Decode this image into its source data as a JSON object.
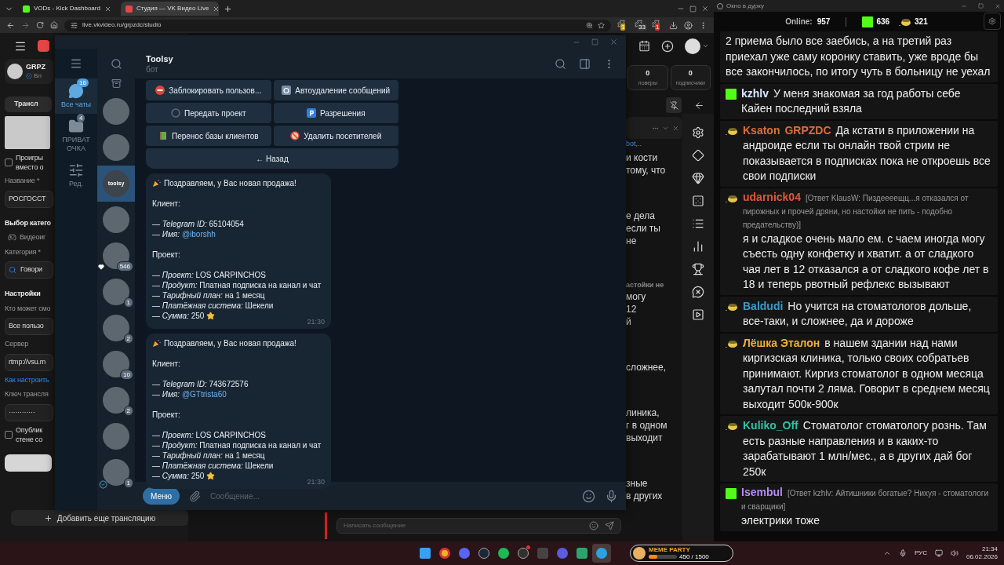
{
  "browser": {
    "tabs": [
      {
        "title": "VODs - Kick Dashboard",
        "selected": false,
        "kind": "kick"
      },
      {
        "title": "Студия — VK Видео Live",
        "selected": true,
        "kind": "vk"
      }
    ],
    "url": "live.vkvideo.ru/grpzdc/studio",
    "extensions": [
      {
        "badge": "1",
        "color": "#c9a227"
      },
      {
        "badge": "33",
        "color": "#3a3a3a"
      },
      {
        "badge": "1",
        "color": "#d93025"
      }
    ]
  },
  "vk_studio": {
    "channel": "GRPZ",
    "channel_sub": "Вл",
    "left_items": [
      {
        "kind": "tab",
        "text": "Трансл"
      },
      {
        "kind": "thumbnail"
      },
      {
        "kind": "checkbox",
        "lines": [
          "Проигры",
          "вместо о"
        ],
        "checked": false
      },
      {
        "kind": "label",
        "text": "Название *"
      },
      {
        "kind": "field",
        "text": "РОСГОССТ"
      },
      {
        "kind": "heading",
        "text": "Выбор катего"
      },
      {
        "kind": "option",
        "text": "Видеоиг"
      },
      {
        "kind": "label",
        "text": "Категория *"
      },
      {
        "kind": "search",
        "text": "Говори"
      },
      {
        "kind": "heading",
        "text": "Настройки"
      },
      {
        "kind": "label",
        "text": "Кто может смо"
      },
      {
        "kind": "field",
        "text": "Все пользо"
      },
      {
        "kind": "label",
        "text": "Сервер"
      },
      {
        "kind": "field",
        "text": "rtmp://vsu.m"
      },
      {
        "kind": "link",
        "text": "Как настроить"
      },
      {
        "kind": "label",
        "text": "Ключ трансля"
      },
      {
        "kind": "field",
        "text": "············"
      },
      {
        "kind": "checkbox",
        "lines": [
          "Опублик",
          "стене со"
        ],
        "checked": false
      },
      {
        "kind": "blank_button"
      }
    ],
    "add_button": "Добавить еще трансляцию",
    "stats": [
      {
        "value": "0",
        "label": "ловеры"
      },
      {
        "value": "0",
        "label": "подписчики"
      }
    ],
    "mention": {
      "name": "bot",
      "rest": ",.."
    },
    "chat_blocks": [
      {
        "lines": [
          "и кости",
          "тому, что"
        ]
      },
      {
        "lines": [
          "е дела",
          "если ты",
          "не"
        ]
      },
      {
        "reply": "астойки не",
        "lines": [
          "могу",
          "12",
          "й"
        ]
      },
      {
        "lines": [
          "сложнее,"
        ]
      },
      {
        "lines": [
          "линика,",
          "г в одном",
          "выходит"
        ]
      },
      {
        "lines": [
          "зные",
          "в других"
        ]
      }
    ],
    "chat_placeholder": "Написать сообщение"
  },
  "telegram": {
    "folders": [
      {
        "kind": "all",
        "label": "Все чаты",
        "badge": "16",
        "selected": true
      },
      {
        "kind": "folder",
        "label": "ПРИВАТ ОЧКА",
        "badge": "4",
        "selected": false
      },
      {
        "kind": "edit",
        "label": "Ред.",
        "selected": false
      }
    ],
    "chats": [
      {
        "selected": false,
        "heart": false,
        "verified": false
      },
      {
        "selected": false,
        "heart": false,
        "verified": false
      },
      {
        "selected": true,
        "logo": "toolsy",
        "heart": false,
        "verified": false
      },
      {
        "selected": false,
        "heart": false,
        "verified": false
      },
      {
        "selected": false,
        "badge": "546",
        "heart": true,
        "verified": false
      },
      {
        "selected": false,
        "badge": "1",
        "heart": false,
        "verified": false
      },
      {
        "selected": false,
        "badge": "2",
        "heart": false,
        "verified": false
      },
      {
        "selected": false,
        "badge": "10",
        "heart": false,
        "verified": false
      },
      {
        "selected": false,
        "badge": "2",
        "heart": false,
        "verified": false
      },
      {
        "selected": false,
        "heart": false,
        "verified": false
      },
      {
        "selected": false,
        "badge": "1",
        "heart": false,
        "verified": true
      }
    ],
    "chat": {
      "name": "Toolsy",
      "status": "бот"
    },
    "keyboard": [
      [
        {
          "kind": "block",
          "text": "Заблокировать пользов..."
        },
        {
          "kind": "timer",
          "text": "Автоудаление сообщений"
        }
      ],
      [
        {
          "kind": "transfer",
          "text": "Передать проект"
        },
        {
          "kind": "permissions",
          "text": "Разрешения"
        }
      ],
      [
        {
          "kind": "migrate",
          "text": "Перенос базы клиентов"
        },
        {
          "kind": "remove",
          "text": "Удалить посетителей"
        }
      ],
      [
        {
          "kind": "back",
          "text": "← Назад"
        }
      ]
    ],
    "messages": [
      {
        "title": "Поздравляем, у Вас новая продажа!",
        "time": "21:30",
        "sections": [
          {
            "heading": "Клиент:",
            "rows": [
              {
                "text": "— *Telegram ID:* 65104054",
                "star": false
              },
              {
                "text": "— *Имя:*",
                "link": "@iborshh",
                "star": false
              }
            ]
          },
          {
            "heading": "Проект:",
            "rows": [
              {
                "text": "— *Проект:* LOS CARPINCHOS",
                "star": false
              },
              {
                "text": "— *Продукт:* Платная подписка на канал и чат",
                "star": false
              },
              {
                "text": "— *Тарифный план:* на 1 месяц",
                "star": false
              },
              {
                "text": "— *Платёжная система:* Шекели",
                "star": false
              },
              {
                "text": "— *Сумма:* 250",
                "star": true
              }
            ]
          }
        ]
      },
      {
        "title": "Поздравляем, у Вас новая продажа!",
        "time": "21:30",
        "sections": [
          {
            "heading": "Клиент:",
            "rows": [
              {
                "text": "— *Telegram ID:* 743672576",
                "star": false
              },
              {
                "text": "— *Имя:*",
                "link": "@GTtrista60",
                "star": false
              }
            ]
          },
          {
            "heading": "Проект:",
            "rows": [
              {
                "text": "— *Проект:* LOS CARPINCHOS",
                "star": false
              },
              {
                "text": "— *Продукт:* Платная подписка на канал и чат",
                "star": false
              },
              {
                "text": "— *Тарифный план:* на 1 месяц",
                "star": false
              },
              {
                "text": "— *Платёжная система:* Шекели",
                "star": false
              },
              {
                "text": "— *Сумма:* 250",
                "star": true
              }
            ]
          }
        ]
      }
    ],
    "input": {
      "menu_button": "Меню",
      "placeholder": "Сообщение..."
    }
  },
  "chat_window": {
    "title": "Окно в дурку",
    "online_label": "Online:",
    "online": "957",
    "counters": [
      {
        "kind": "kick",
        "value": "636"
      },
      {
        "kind": "pot",
        "value": "321"
      }
    ],
    "messages": [
      {
        "kind": "none",
        "text": "2 приема было все заебись, а на третий раз приехал уже саму коронку ставить, уже вроде бы все закончилось, по итогу чуть в больницу не уехал"
      },
      {
        "kind": "kick",
        "user": "kzhlv",
        "color": "#dce8ff",
        "text": "У меня знакомая за год работы себе Кайен последний взяла"
      },
      {
        "kind": "pot",
        "user": "Ksaton",
        "mention": "GRPZDC",
        "color": "#e06c3c",
        "text": "Да кстати в приложении на андроиде  если ты онлайн твой стрим не показывается  в подписках пока не откроешь все свои подписки"
      },
      {
        "kind": "pot",
        "user": "udarnick04",
        "color": "#e0553a",
        "reply": "[Ответ KlausW: Пиздеееещц...я отказался от пирожных и прочей дряни, но настойки не пить - подобно предательству)]",
        "text": "я и сладкое очень мало ем. с чаем иногда могу съесть одну конфетку и хватит. а от сладкого чая лет в 12 отказался а от сладкого кофе лет в 18 и теперь рвотный рефлекс вызывают"
      },
      {
        "kind": "pot",
        "user": "Baldudi",
        "color": "#3a9cc8",
        "text": "Но учится на стоматологов дольше, все-таки, и сложнее, да и дороже"
      },
      {
        "kind": "pot",
        "user": "Лёшка Эталон",
        "color": "#f0b035",
        "text": "в нашем здании над нами киргизская клиника, только своих собратьев принимают. Киргиз стоматолог в одном месяца залутал почти 2 ляма. Говорит в среднем месяц выходит 500к-900к"
      },
      {
        "kind": "pot",
        "user": "Kuliko_Off",
        "color": "#35c0a4",
        "text": "Стоматолог стоматологу рознь. Там есть разные направления и в каких-то зарабатывают 1 млн/мес., а в других дай бог 250к"
      },
      {
        "kind": "kick",
        "user": "Isembul",
        "color": "#b58cf0",
        "reply": "[Ответ kzhlv: Айтишники богатые? Нихуя - стоматологи и сварщики]",
        "text": "электрики тоже"
      }
    ]
  },
  "taskbar": {
    "apps": [
      {
        "kind": "windows",
        "active": false,
        "alert": false
      },
      {
        "kind": "chrome",
        "active": false,
        "alert": false
      },
      {
        "kind": "discord",
        "active": false,
        "alert": false
      },
      {
        "kind": "steam",
        "active": false,
        "alert": false
      },
      {
        "kind": "spotify",
        "active": false,
        "alert": false
      },
      {
        "kind": "obs",
        "active": false,
        "alert": true
      },
      {
        "kind": "app",
        "active": false,
        "alert": false
      },
      {
        "kind": "player",
        "active": false,
        "alert": false
      },
      {
        "kind": "snip",
        "active": false,
        "alert": false
      },
      {
        "kind": "telegram",
        "active": true,
        "alert": false
      }
    ],
    "widget": {
      "title": "MEME PARTY",
      "progress": "450 / 1500",
      "level": 0.3
    },
    "language": "РУС",
    "time": "21:34",
    "date": "06.02.2026"
  }
}
